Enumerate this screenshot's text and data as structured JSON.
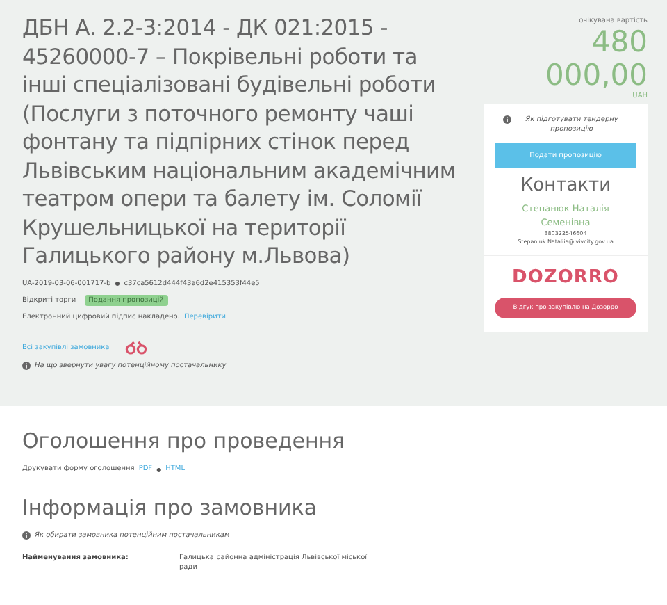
{
  "tender": {
    "title": "ДБН А. 2.2-3:2014 - ДК 021:2015 - 45260000-7 – Покрівельні роботи та інші спеціалізовані будівельні роботи (Послуги з поточного ремонту чаші фонтану та підпірних стінок перед Львівським національним академічним театром опери та балету ім. Соломії Крушельницької на території Галицького району м.Львова)",
    "id": "UA-2019-03-06-001717-b",
    "separator": "●",
    "hash": "c37ca5612d444f43a6d2e415353f44e5",
    "procedure": "Відкриті торги",
    "status": "Подання пропозицій",
    "signature": "Електронний цифровий підпис накладено.",
    "verify_link": "Перевірити",
    "buyer_link": "Всі закупівлі замовника",
    "hint": "На що звернути увагу потенційному постачальнику"
  },
  "price": {
    "caption": "очікувана вартість",
    "amount": "480 000,00",
    "currency": "UAH"
  },
  "side_card": {
    "help": "Як підготувати тендерну пропозицію",
    "submit_button": "Подати пропозицію",
    "contacts_title": "Контакти",
    "contact_name": "Степанюк Наталія Семенівна",
    "phone": "380322546604",
    "email": "Stepaniuk.Nataliia@lvivcity.gov.ua",
    "logo": "DOZORRO",
    "review_button": "Відгук про закупівлю на Дозорро"
  },
  "announcement": {
    "heading": "Оголошення про проведення",
    "print_label": "Друкувати форму оголошення",
    "pdf_link": "PDF",
    "separator": "●",
    "html_link": "HTML"
  },
  "buyer_info": {
    "heading": "Інформація про замовника",
    "hint": "Як обирати замовника потенційним постачальникам",
    "fields": [
      {
        "label": "Найменування замовника:",
        "value": "Галицька районна адміністрація Львівської міської ради"
      }
    ]
  }
}
